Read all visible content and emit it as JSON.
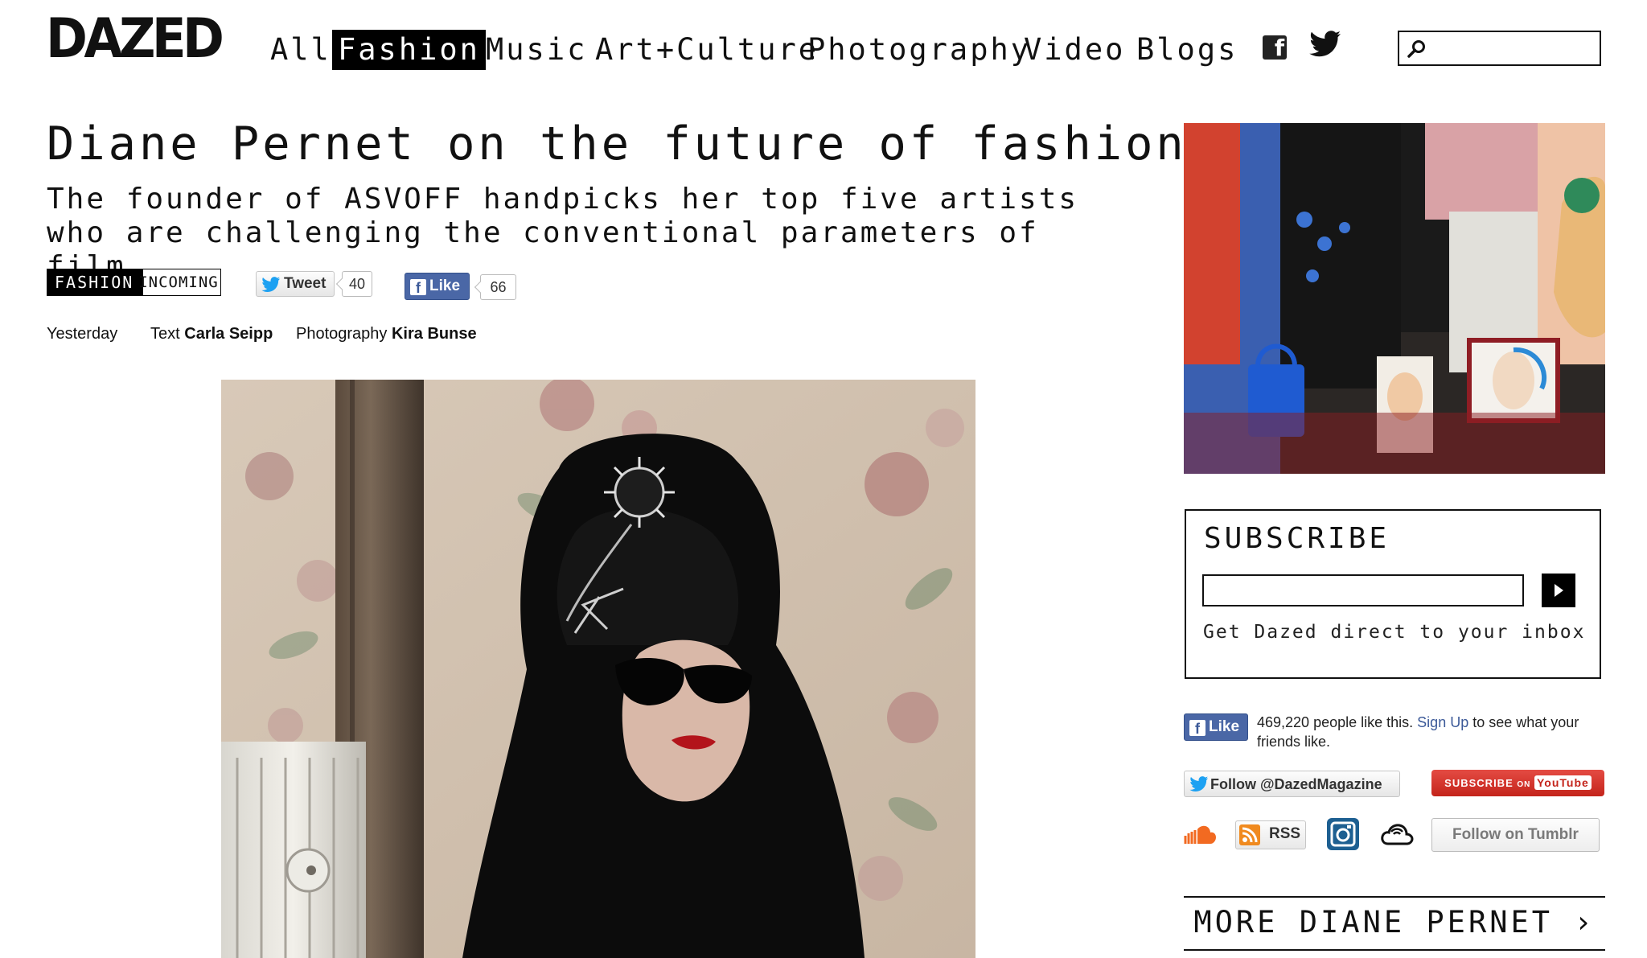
{
  "site": {
    "logo": "DAZED"
  },
  "nav": {
    "items": [
      {
        "label": "All",
        "active": false
      },
      {
        "label": "Fashion",
        "active": true
      },
      {
        "label": "Music",
        "active": false
      },
      {
        "label": "Art+Culture",
        "active": false
      },
      {
        "label": "Photography",
        "active": false
      },
      {
        "label": "Video",
        "active": false
      },
      {
        "label": "Blogs",
        "active": false
      }
    ],
    "social": [
      "facebook-icon",
      "twitter-icon"
    ],
    "search": {
      "placeholder": "",
      "icon": "search-icon"
    }
  },
  "article": {
    "title": "Diane Pernet on the future of fashion film",
    "dek": "The founder of ASVOFF handpicks her top five artists who are challenging the conventional parameters of film",
    "tags": [
      "FASHION",
      "INCOMING"
    ],
    "share": {
      "tweet_label": "Tweet",
      "tweet_count": "40",
      "like_label": "Like",
      "like_count": "66"
    },
    "meta": {
      "date": "Yesterday",
      "text_label": "Text",
      "author": "Carla Seipp",
      "photo_label": "Photography",
      "photographer": "Kira Bunse"
    }
  },
  "sidebar": {
    "subscribe": {
      "title": "SUBSCRIBE",
      "input_placeholder": "",
      "note": "Get Dazed direct to your inbox"
    },
    "facebook": {
      "like_label": "Like",
      "count_text": "469,220 people like this.",
      "signup_label": "Sign Up",
      "suffix_text": "to see what your friends like."
    },
    "follow_twitter": "Follow @DazedMagazine",
    "youtube": {
      "prefix": "SUBSCRIBE",
      "on": "ON",
      "brand": "YouTube"
    },
    "icons": [
      "soundcloud-icon",
      "rss-icon",
      "instagram-icon",
      "cloud-icon"
    ],
    "rss_label": "RSS",
    "tumblr_label": "Follow on Tumblr",
    "more": {
      "title": "MORE DIANE PERNET",
      "arrow": "›"
    }
  },
  "colors": {
    "facebook": "#4a67a6",
    "youtube": "#d3332a",
    "twitter": "#1da1f2",
    "link": "#3b5998"
  }
}
